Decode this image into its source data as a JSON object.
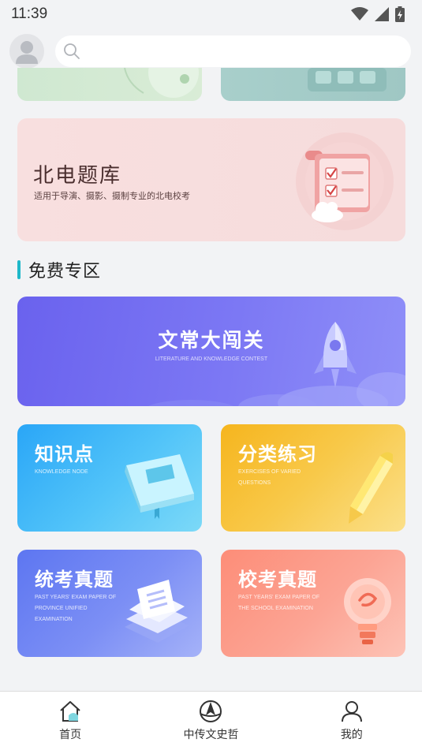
{
  "status": {
    "time": "11:39"
  },
  "search": {
    "placeholder": ""
  },
  "beidian": {
    "title": "北电题库",
    "subtitle": "适用于导演、摄影、摄制专业的北电校考"
  },
  "section": {
    "free_title": "免费专区"
  },
  "contest": {
    "title": "文常大闯关",
    "subtitle": "LITERATURE AND KNOWLEDGE CONTEST"
  },
  "cards": {
    "knowledge": {
      "title": "知识点",
      "subtitle": "KNOWLEDGE NODE"
    },
    "exercise": {
      "title": "分类练习",
      "subtitle": "EXERCISES OF VARIED QUESTIONS"
    },
    "unified": {
      "title": "统考真题",
      "subtitle": "PAST YEARS' EXAM PAPER OF PROVINCE UNIFIED EXAMINATION"
    },
    "school": {
      "title": "校考真题",
      "subtitle": "PAST YEARS' EXAM PAPER OF THE SCHOOL EXAMINATION"
    }
  },
  "tabs": [
    {
      "label": "首页",
      "icon": "home-icon"
    },
    {
      "label": "中传文史哲",
      "icon": "compass-logo-icon"
    },
    {
      "label": "我的",
      "icon": "person-icon"
    }
  ],
  "colors": {
    "accent": "#1fb8c9",
    "contest": "#6a62ee",
    "knowledge": "#2aa6f7",
    "exercise": "#f6b51e",
    "unified": "#5d76f1",
    "school": "#fd8d78"
  }
}
